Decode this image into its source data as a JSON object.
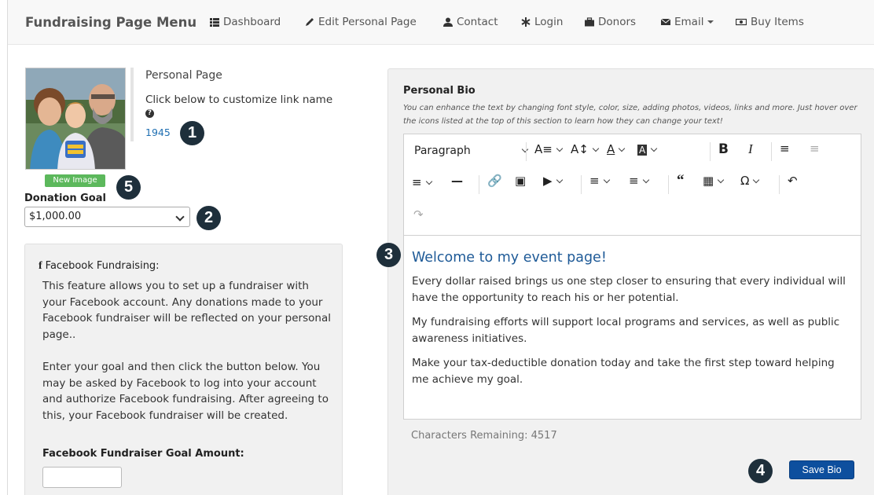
{
  "navbar": {
    "brand": "Fundraising Page Menu",
    "items": [
      {
        "label": "Dashboard",
        "icon": "grid-icon"
      },
      {
        "label": "Edit Personal Page",
        "icon": "pencil-icon"
      },
      {
        "label": "Contact",
        "icon": "user-icon"
      },
      {
        "label": "Login",
        "icon": "asterisk-icon"
      },
      {
        "label": "Donors",
        "icon": "briefcase-icon"
      },
      {
        "label": "Email",
        "icon": "envelope-icon"
      },
      {
        "label": "Buy Items",
        "icon": "money-icon"
      }
    ]
  },
  "personal_page": {
    "title": "Personal Page",
    "subtitle": "Click below to customize link name",
    "link_id": "1945",
    "new_image_label": "New Image"
  },
  "donation_goal": {
    "label": "Donation Goal",
    "value": "$1,000.00"
  },
  "facebook": {
    "title": "Facebook Fundraising:",
    "paragraph1": "This feature allows you to set up a fundraiser with your Facebook account. Any donations made to your Facebook fundraiser will be reflected on your personal page..",
    "paragraph2": "Enter your goal and then click the button below. You may be asked by Facebook to log into your account and authorize Facebook fundraising. After agreeing to this, your Facebook fundraiser will be created.",
    "goal_label": "Facebook Fundraiser Goal Amount:",
    "goal_value": ""
  },
  "bio": {
    "title": "Personal Bio",
    "help": "You can enhance the text by changing font style, color, size, adding photos, videos, links and more. Just hover over the icons listed at the top of this section to learn how they can change your text!",
    "format_value": "Paragraph",
    "heading": "Welcome to my event page!",
    "paragraphs": [
      "Every dollar raised brings us one step closer to ensuring that every individual will have the opportunity to reach his or her potential.",
      "My fundraising efforts will support local programs and services, as well as public awareness initiatives.",
      "Make your tax-deductible donation today and take the first step toward helping me achieve my goal."
    ],
    "chars_remaining": "Characters Remaining: 4517",
    "save_label": "Save Bio"
  },
  "callouts": [
    "1",
    "2",
    "3",
    "4",
    "5"
  ],
  "colors": {
    "accent_link": "#1f6fb2",
    "save_button": "#0d4f9e",
    "new_image_button": "#5cb85c",
    "callout_badge": "#1e2f3b",
    "heading_text": "#1e5a97"
  }
}
